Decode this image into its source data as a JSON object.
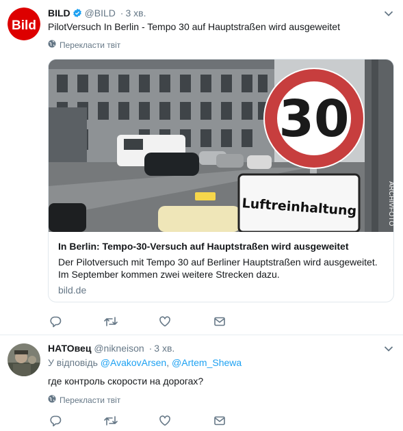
{
  "tweets": [
    {
      "name": "BILD",
      "handle": "@BILD",
      "separator": "·",
      "time": "3 хв.",
      "text": "PilotVersuch In Berlin - Tempo 30 auf Hauptstraßen wird ausgeweitet",
      "translate": "Перекласти твіт",
      "avatar_logo": "Bild",
      "verified": true,
      "card": {
        "sign_number": "30",
        "sign_plate": "Luftreinhaltung",
        "watermark": "ARCHIVFOTO",
        "title": "In Berlin: Tempo-30-Versuch auf Hauptstraßen wird ausgeweitet",
        "desc_line1": "Der Pilotversuch mit Tempo 30 auf Berliner Hauptstraßen wird ausgeweitet.",
        "desc_line2": "Im September kommen zwei weitere Strecken dazu.",
        "domain": "bild.de"
      }
    },
    {
      "name": "НАТОвец",
      "handle": "@nikneison",
      "separator": "·",
      "time": "3 хв.",
      "reply_prefix": "У відповідь",
      "reply_user1": "@AvakovArsen",
      "reply_comma": ",",
      "reply_user2": "@Artem_Shewa",
      "text": "где контроль скорости на дорогах?",
      "translate": "Перекласти твіт"
    }
  ],
  "colors": {
    "accent": "#1da1f2",
    "muted": "#657786",
    "text": "#14171a",
    "bild_red": "#dd0000",
    "border": "#e6ecf0"
  },
  "icons": [
    "reply-icon",
    "retweet-icon",
    "like-icon",
    "message-icon",
    "globe-icon",
    "chevron-down-icon",
    "verified-icon"
  ]
}
